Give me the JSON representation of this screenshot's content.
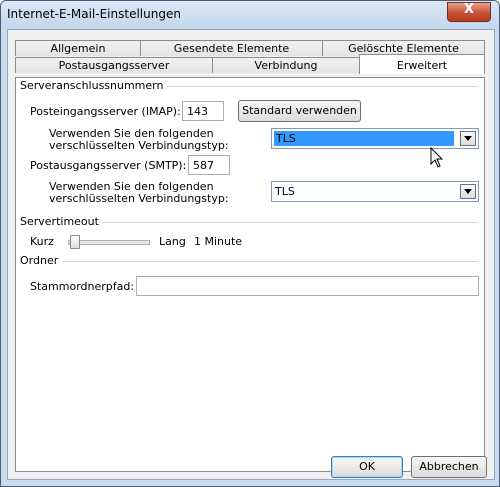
{
  "window": {
    "title": "Internet-E-Mail-Einstellungen",
    "close_glyph": "X"
  },
  "tabs": {
    "row1": [
      "Allgemein",
      "Gesendete Elemente",
      "Gelöschte Elemente"
    ],
    "row2": [
      "Postausgangsserver",
      "Verbindung",
      "Erweitert"
    ],
    "active": "Erweitert"
  },
  "server_ports": {
    "section_label": "Serveranschlussnummern",
    "imap_label": "Posteingangsserver (IMAP):",
    "imap_value": "143",
    "default_button": "Standard verwenden",
    "imap_enc_label_1": "Verwenden Sie den folgenden",
    "imap_enc_label_2": "verschlüsselten Verbindungstyp:",
    "imap_enc_value": "TLS",
    "smtp_label": "Postausgangsserver (SMTP):",
    "smtp_value": "587",
    "smtp_enc_label_1": "Verwenden Sie den folgenden",
    "smtp_enc_label_2": "verschlüsselten Verbindungstyp:",
    "smtp_enc_value": "TLS"
  },
  "timeout": {
    "section_label": "Servertimeout",
    "short_label": "Kurz",
    "long_label": "Lang",
    "value_text": "1 Minute",
    "level": 0.0
  },
  "folders": {
    "section_label": "Ordner",
    "root_label": "Stammordnerpfad:",
    "root_value": ""
  },
  "footer": {
    "ok": "OK",
    "cancel": "Abbrechen"
  },
  "colors": {
    "selection": "#3399ff",
    "close_button": "#c75036",
    "frame": "#c9dcef"
  }
}
